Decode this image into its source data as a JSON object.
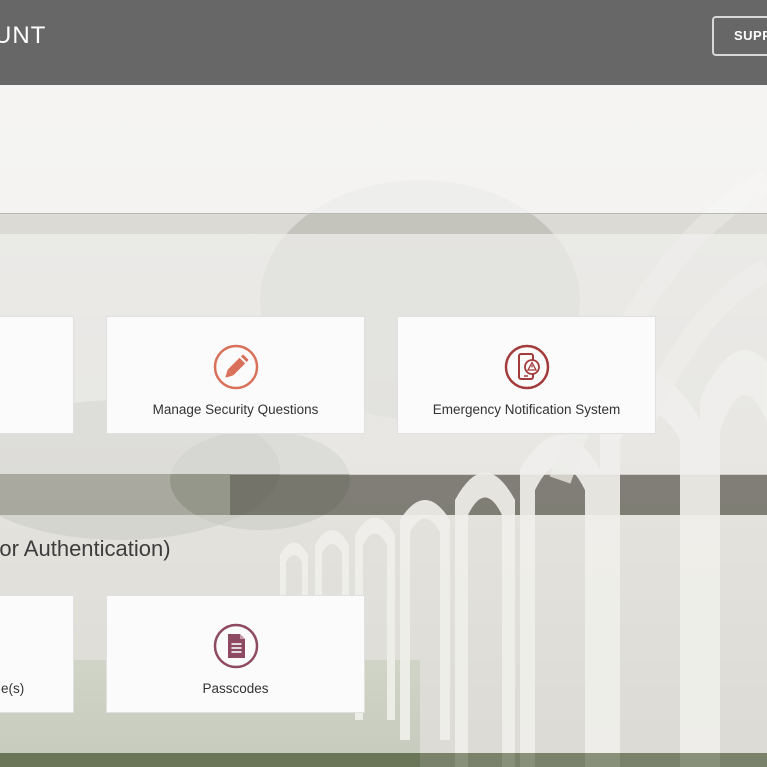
{
  "header": {
    "title": "UNT",
    "support_label": "SUPPORT"
  },
  "sections": {
    "security": {
      "tiles": [
        {
          "label": ""
        },
        {
          "label": "Manage Security Questions",
          "icon": "pencil-icon"
        },
        {
          "label": "Emergency Notification System",
          "icon": "mobile-alert-icon"
        }
      ]
    },
    "mfa": {
      "heading": "actor Authentication)",
      "tiles": [
        {
          "label": "e(s)"
        },
        {
          "label": "Passcodes",
          "icon": "document-icon"
        }
      ]
    }
  },
  "colors": {
    "header_bg": "#676767",
    "pencil_icon": "#d9705a",
    "alert_icon": "#a33b3b",
    "document_icon": "#8e4a62"
  }
}
